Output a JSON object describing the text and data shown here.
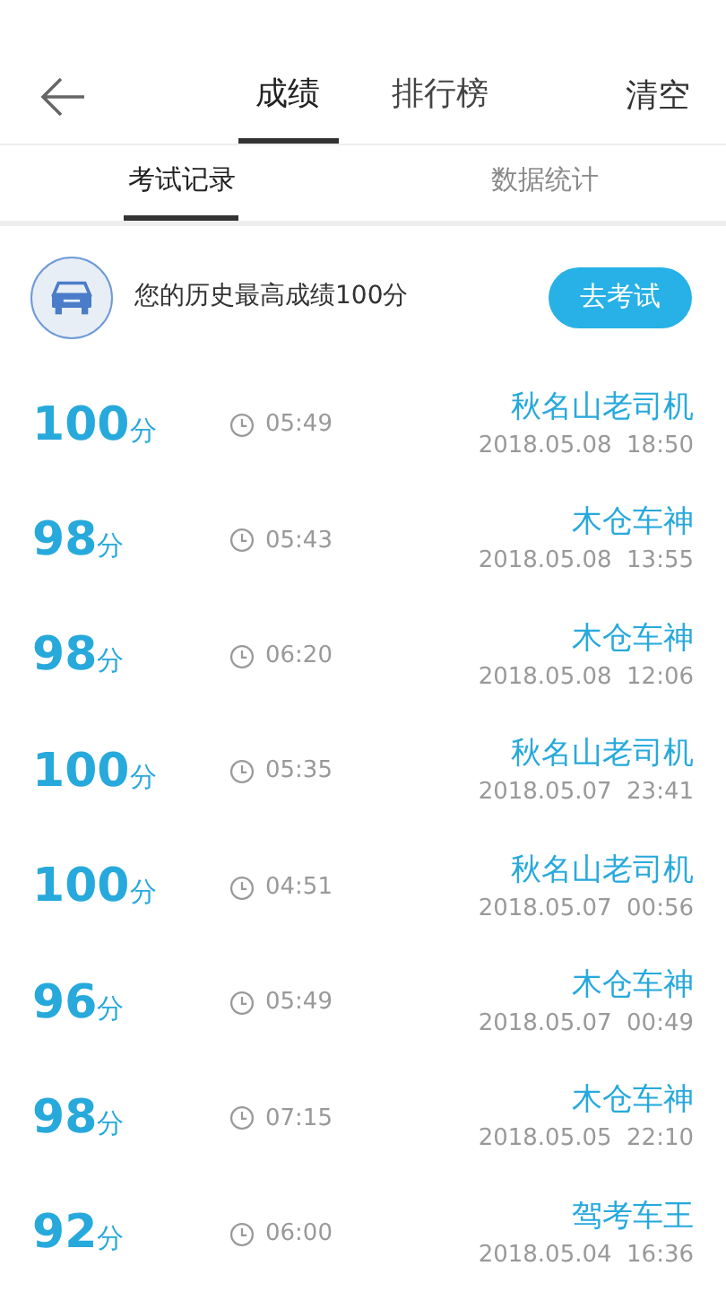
{
  "header": {
    "tabs": [
      {
        "label": "成绩",
        "selected": true
      },
      {
        "label": "排行榜",
        "selected": false
      }
    ],
    "action": "清空"
  },
  "subtabs": [
    {
      "label": "考试记录",
      "selected": true
    },
    {
      "label": "数据统计",
      "selected": false
    }
  ],
  "summary": {
    "text": "您的历史最高成绩100分",
    "button": "去考试"
  },
  "records": [
    {
      "score": "100",
      "unit": "分",
      "duration": "05:49",
      "title": "秋名山老司机",
      "date": "2018.05.08  18:50"
    },
    {
      "score": "98",
      "unit": "分",
      "duration": "05:43",
      "title": "木仓车神",
      "date": "2018.05.08  13:55"
    },
    {
      "score": "98",
      "unit": "分",
      "duration": "06:20",
      "title": "木仓车神",
      "date": "2018.05.08  12:06"
    },
    {
      "score": "100",
      "unit": "分",
      "duration": "05:35",
      "title": "秋名山老司机",
      "date": "2018.05.07  23:41"
    },
    {
      "score": "100",
      "unit": "分",
      "duration": "04:51",
      "title": "秋名山老司机",
      "date": "2018.05.07  00:56"
    },
    {
      "score": "96",
      "unit": "分",
      "duration": "05:49",
      "title": "木仓车神",
      "date": "2018.05.07  00:49"
    },
    {
      "score": "98",
      "unit": "分",
      "duration": "07:15",
      "title": "木仓车神",
      "date": "2018.05.05  22:10"
    },
    {
      "score": "92",
      "unit": "分",
      "duration": "06:00",
      "title": "驾考车王",
      "date": "2018.05.04  16:36"
    }
  ]
}
